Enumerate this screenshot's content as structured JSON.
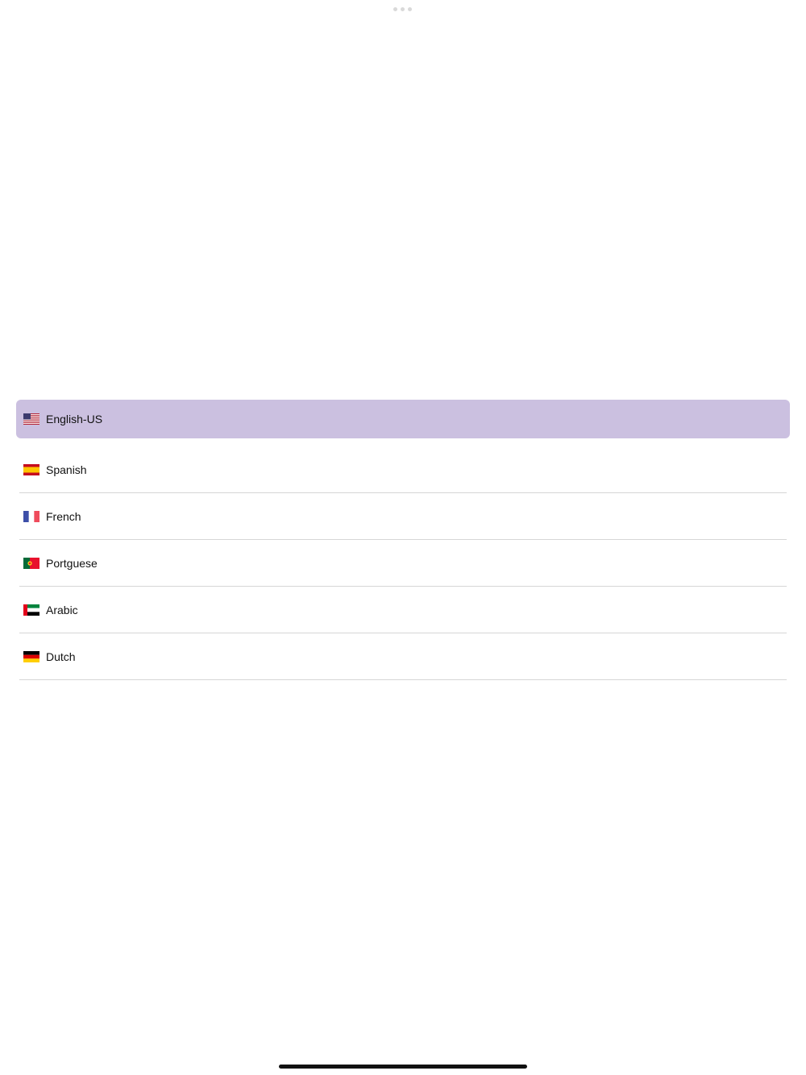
{
  "languages": [
    {
      "label": "English-US",
      "flag": "us-flag-icon",
      "selected": true
    },
    {
      "label": "Spanish",
      "flag": "spain-flag-icon",
      "selected": false
    },
    {
      "label": "French",
      "flag": "france-flag-icon",
      "selected": false
    },
    {
      "label": "Portguese",
      "flag": "portugal-flag-icon",
      "selected": false
    },
    {
      "label": "Arabic",
      "flag": "uae-flag-icon",
      "selected": false
    },
    {
      "label": "Dutch",
      "flag": "germany-flag-icon",
      "selected": false
    }
  ],
  "colors": {
    "selected_background": "#cbc0e0",
    "divider": "#d6d6d6"
  }
}
